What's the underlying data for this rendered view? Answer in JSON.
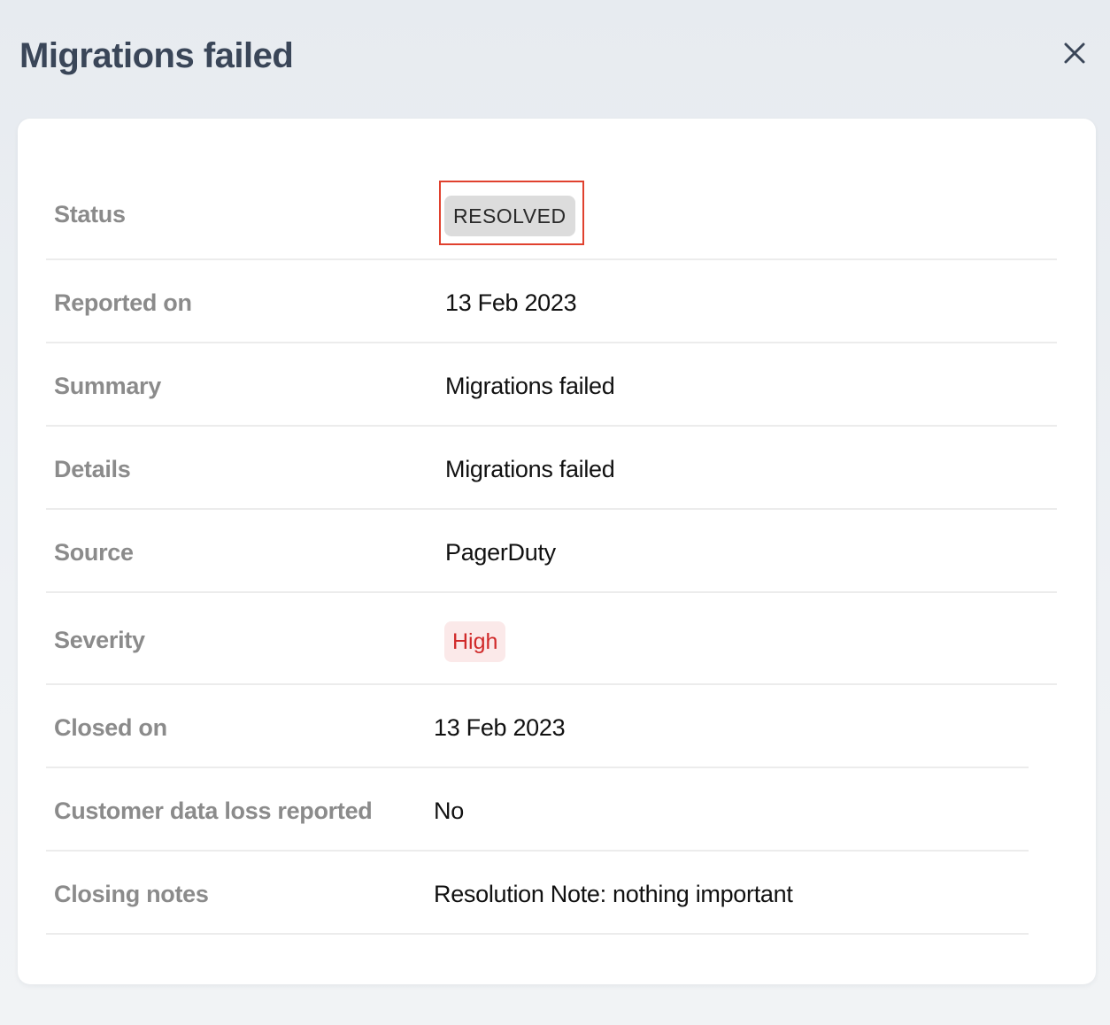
{
  "header": {
    "title": "Migrations failed",
    "close_icon": "close-icon"
  },
  "details": {
    "status": {
      "label": "Status",
      "value": "RESOLVED"
    },
    "reported_on": {
      "label": "Reported on",
      "value": "13 Feb 2023"
    },
    "summary": {
      "label": "Summary",
      "value": "Migrations failed"
    },
    "details": {
      "label": "Details",
      "value": "Migrations failed"
    },
    "source": {
      "label": "Source",
      "value": "PagerDuty"
    },
    "severity": {
      "label": "Severity",
      "value": "High"
    },
    "closed_on": {
      "label": "Closed on",
      "value": "13 Feb 2023"
    },
    "customer_data_loss": {
      "label": "Customer data loss reported",
      "value": "No"
    },
    "closing_notes": {
      "label": "Closing notes",
      "value": "Resolution Note: nothing important"
    }
  },
  "colors": {
    "title": "#3a4658",
    "label": "#8b8b8b",
    "value": "#111111",
    "status_badge_bg": "#dcdcdc",
    "severity_badge_bg": "#fbe9e9",
    "severity_text": "#d02a2a",
    "highlight_border": "#e0412e"
  }
}
